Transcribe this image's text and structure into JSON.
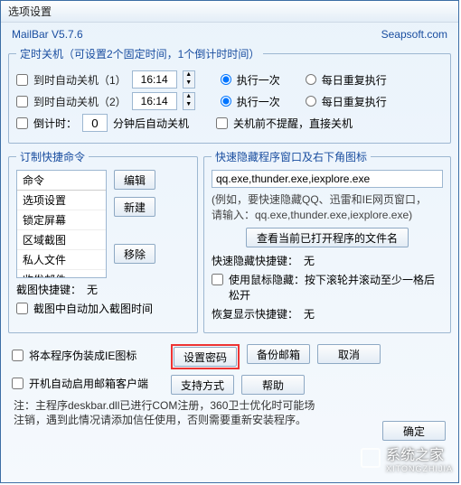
{
  "window_title": "选项设置",
  "header": {
    "left": "MailBar V5.7.6",
    "right": "Seapsoft.com"
  },
  "shutdown": {
    "legend": "定时关机（可设置2个固定时间，1个倒计时时间）",
    "row1_label": "到时自动关机（1）",
    "row2_label": "到时自动关机（2）",
    "time1": "16:14",
    "time2": "16:14",
    "opt_once": "执行一次",
    "opt_daily": "每日重复执行",
    "countdown_label": "倒计时：",
    "countdown_value": "0",
    "countdown_suffix": "分钟后自动关机",
    "no_remind": "关机前不提醒，直接关机"
  },
  "shortcut": {
    "legend": "订制快捷命令",
    "col_header": "命令",
    "items": [
      "选项设置",
      "锁定屏幕",
      "区域截图",
      "私人文件",
      "收发邮件"
    ],
    "btn_edit": "编辑",
    "btn_new": "新建",
    "btn_remove": "移除",
    "cap_hotkey_label": "截图快捷键：",
    "cap_hotkey_value": "无",
    "cap_addtime": "截图中自动加入截图时间"
  },
  "hide": {
    "legend": "快速隐藏程序窗口及右下角图标",
    "example_input": "qq.exe,thunder.exe,iexplore.exe",
    "hint1": "(例如，要快速隐藏QQ、迅雷和IE网页窗口，",
    "hint2": "请输入：qq.exe,thunder.exe,iexplore.exe)",
    "btn_view": "查看当前已打开程序的文件名",
    "hide_hotkey_label": "快速隐藏快捷键：",
    "hide_hotkey_value": "无",
    "mouse_hide": "使用鼠标隐藏：按下滚轮并滚动至少一格后松开",
    "restore_label": "恢复显示快捷键：",
    "restore_value": "无"
  },
  "bottom": {
    "fake_ie": "将本程序伪装成IE图标",
    "autorun": "开机自动启用邮箱客户端",
    "btn_password": "设置密码",
    "btn_backup": "备份邮箱",
    "btn_cancel": "取消",
    "btn_support": "支持方式",
    "btn_help": "帮助",
    "btn_confirm": "确定"
  },
  "note": {
    "line1": "注：主程序deskbar.dll已进行COM注册，360卫士优化时可能场",
    "line2": "注销，遇到此情况请添加信任使用，否则需要重新安装程序。"
  },
  "watermark": {
    "text": "系统之家",
    "sub": "XITONGZHIJIA"
  }
}
